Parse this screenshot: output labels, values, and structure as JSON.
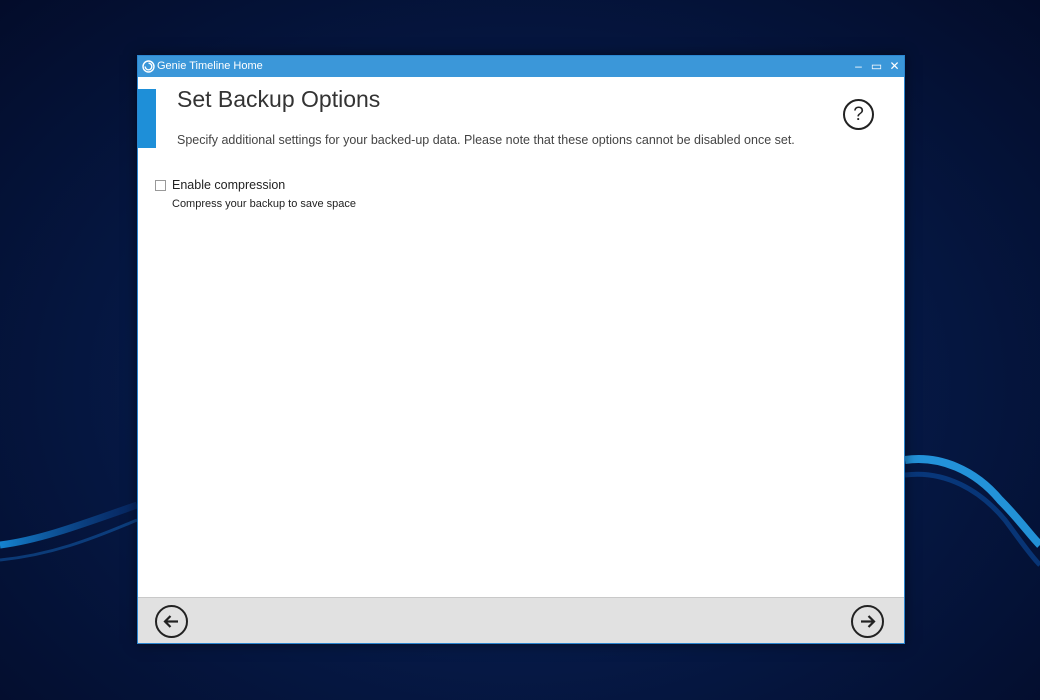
{
  "window": {
    "title": "Genie Timeline Home",
    "minimize_glyph": "–",
    "maximize_glyph": "▭",
    "close_glyph": "✕"
  },
  "page": {
    "title": "Set Backup Options",
    "subtitle": "Specify additional settings for your backed-up data. Please note that these options cannot be disabled once set.",
    "help_glyph": "?"
  },
  "options": [
    {
      "label": "Enable compression",
      "description": "Compress your backup to save space",
      "checked": false
    }
  ],
  "footer": {
    "back_icon": "arrow-left-icon",
    "next_icon": "arrow-right-icon"
  },
  "colors": {
    "titlebar": "#3b97d9",
    "accent": "#1e8fd8",
    "footer": "#e1e1e1"
  }
}
